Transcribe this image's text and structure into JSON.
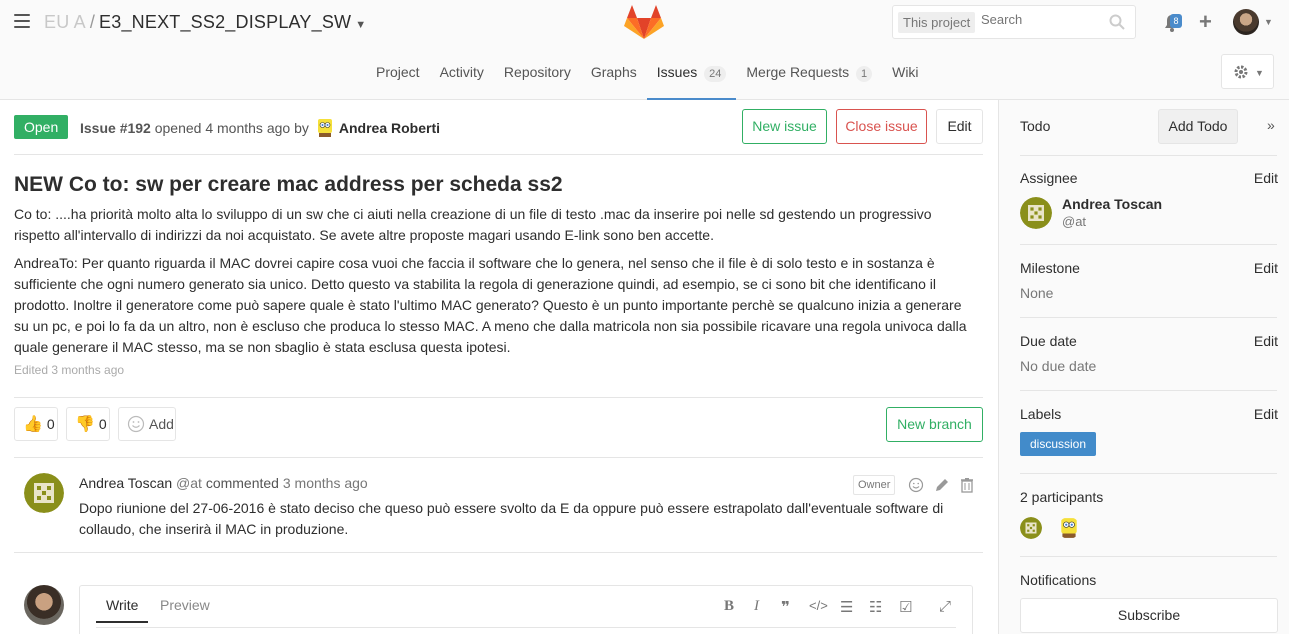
{
  "header": {
    "breadcrumb_group": "EU    A",
    "breadcrumb_sep": "/",
    "project_name": "E3_NEXT_SS2_DISPLAY_SW",
    "search_scope": "This project",
    "search_placeholder": "Search",
    "notification_count": "8"
  },
  "nav": {
    "items": [
      {
        "label": "Project"
      },
      {
        "label": "Activity"
      },
      {
        "label": "Repository"
      },
      {
        "label": "Graphs"
      },
      {
        "label": "Issues",
        "count": "24",
        "active": true
      },
      {
        "label": "Merge Requests",
        "count": "1"
      },
      {
        "label": "Wiki"
      }
    ]
  },
  "issue": {
    "status": "Open",
    "number": "Issue #192",
    "opened_text": "opened",
    "time": "4 months ago",
    "by_text": "by",
    "author": "Andrea Roberti",
    "new_issue_label": "New issue",
    "close_issue_label": "Close issue",
    "edit_label": "Edit",
    "title": "NEW Co    to: sw per creare mac address per scheda ss2",
    "description_p1": "Co    to: ....ha priorità molto alta lo sviluppo di un sw che ci aiuti nella creazione di un file di testo .mac da inserire poi nelle sd gestendo un progressivo rispetto all'intervallo di indirizzi da noi acquistato. Se avete altre proposte magari usando E-link sono ben accette.",
    "description_p2": "AndreaTo: Per quanto riguarda il MAC dovrei capire cosa vuoi che faccia il software che lo genera, nel senso che il file è di solo testo e in sostanza è sufficiente che ogni numero generato sia unico. Detto questo va stabilita la regola di generazione quindi, ad esempio, se ci sono bit che identificano il prodotto. Inoltre il generatore come può sapere quale è stato l'ultimo MAC generato? Questo è un punto importante perchè se qualcuno inizia a generare su un pc, e poi lo fa da un altro, non è escluso che produca lo stesso MAC. A meno che dalla matricola non sia possibile ricavare una regola univoca dalla quale generare il MAC stesso, ma se non sbaglio è stata esclusa questa ipotesi.",
    "edited_text": "Edited 3 months ago",
    "thumbs_up": "0",
    "thumbs_down": "0",
    "add_award_label": "Add",
    "new_branch_label": "New branch"
  },
  "note": {
    "author": "Andrea Toscan",
    "handle": "@at",
    "action": "commented",
    "time": "3 months ago",
    "role": "Owner",
    "body": "Dopo riunione del 27-06-2016 è stato deciso che queso può essere svolto da E       da oppure può essere estrapolato dall'eventuale software di collaudo, che inserirà il MAC in produzione."
  },
  "editor": {
    "write_tab": "Write",
    "preview_tab": "Preview"
  },
  "sidebar": {
    "todo_label": "Todo",
    "add_todo_label": "Add Todo",
    "assignee_label": "Assignee",
    "assignee_name": "Andrea Toscan",
    "assignee_handle": "@at",
    "milestone_label": "Milestone",
    "milestone_value": "None",
    "due_date_label": "Due date",
    "due_date_value": "No due date",
    "labels_label": "Labels",
    "label_chip": "discussion",
    "participants_label": "2 participants",
    "notifications_label": "Notifications",
    "subscribe_label": "Subscribe",
    "edit_label": "Edit"
  },
  "colors": {
    "accent": "#4a8bcb",
    "success": "#31af64",
    "danger": "#d9534f",
    "label_blue": "#428bca"
  }
}
